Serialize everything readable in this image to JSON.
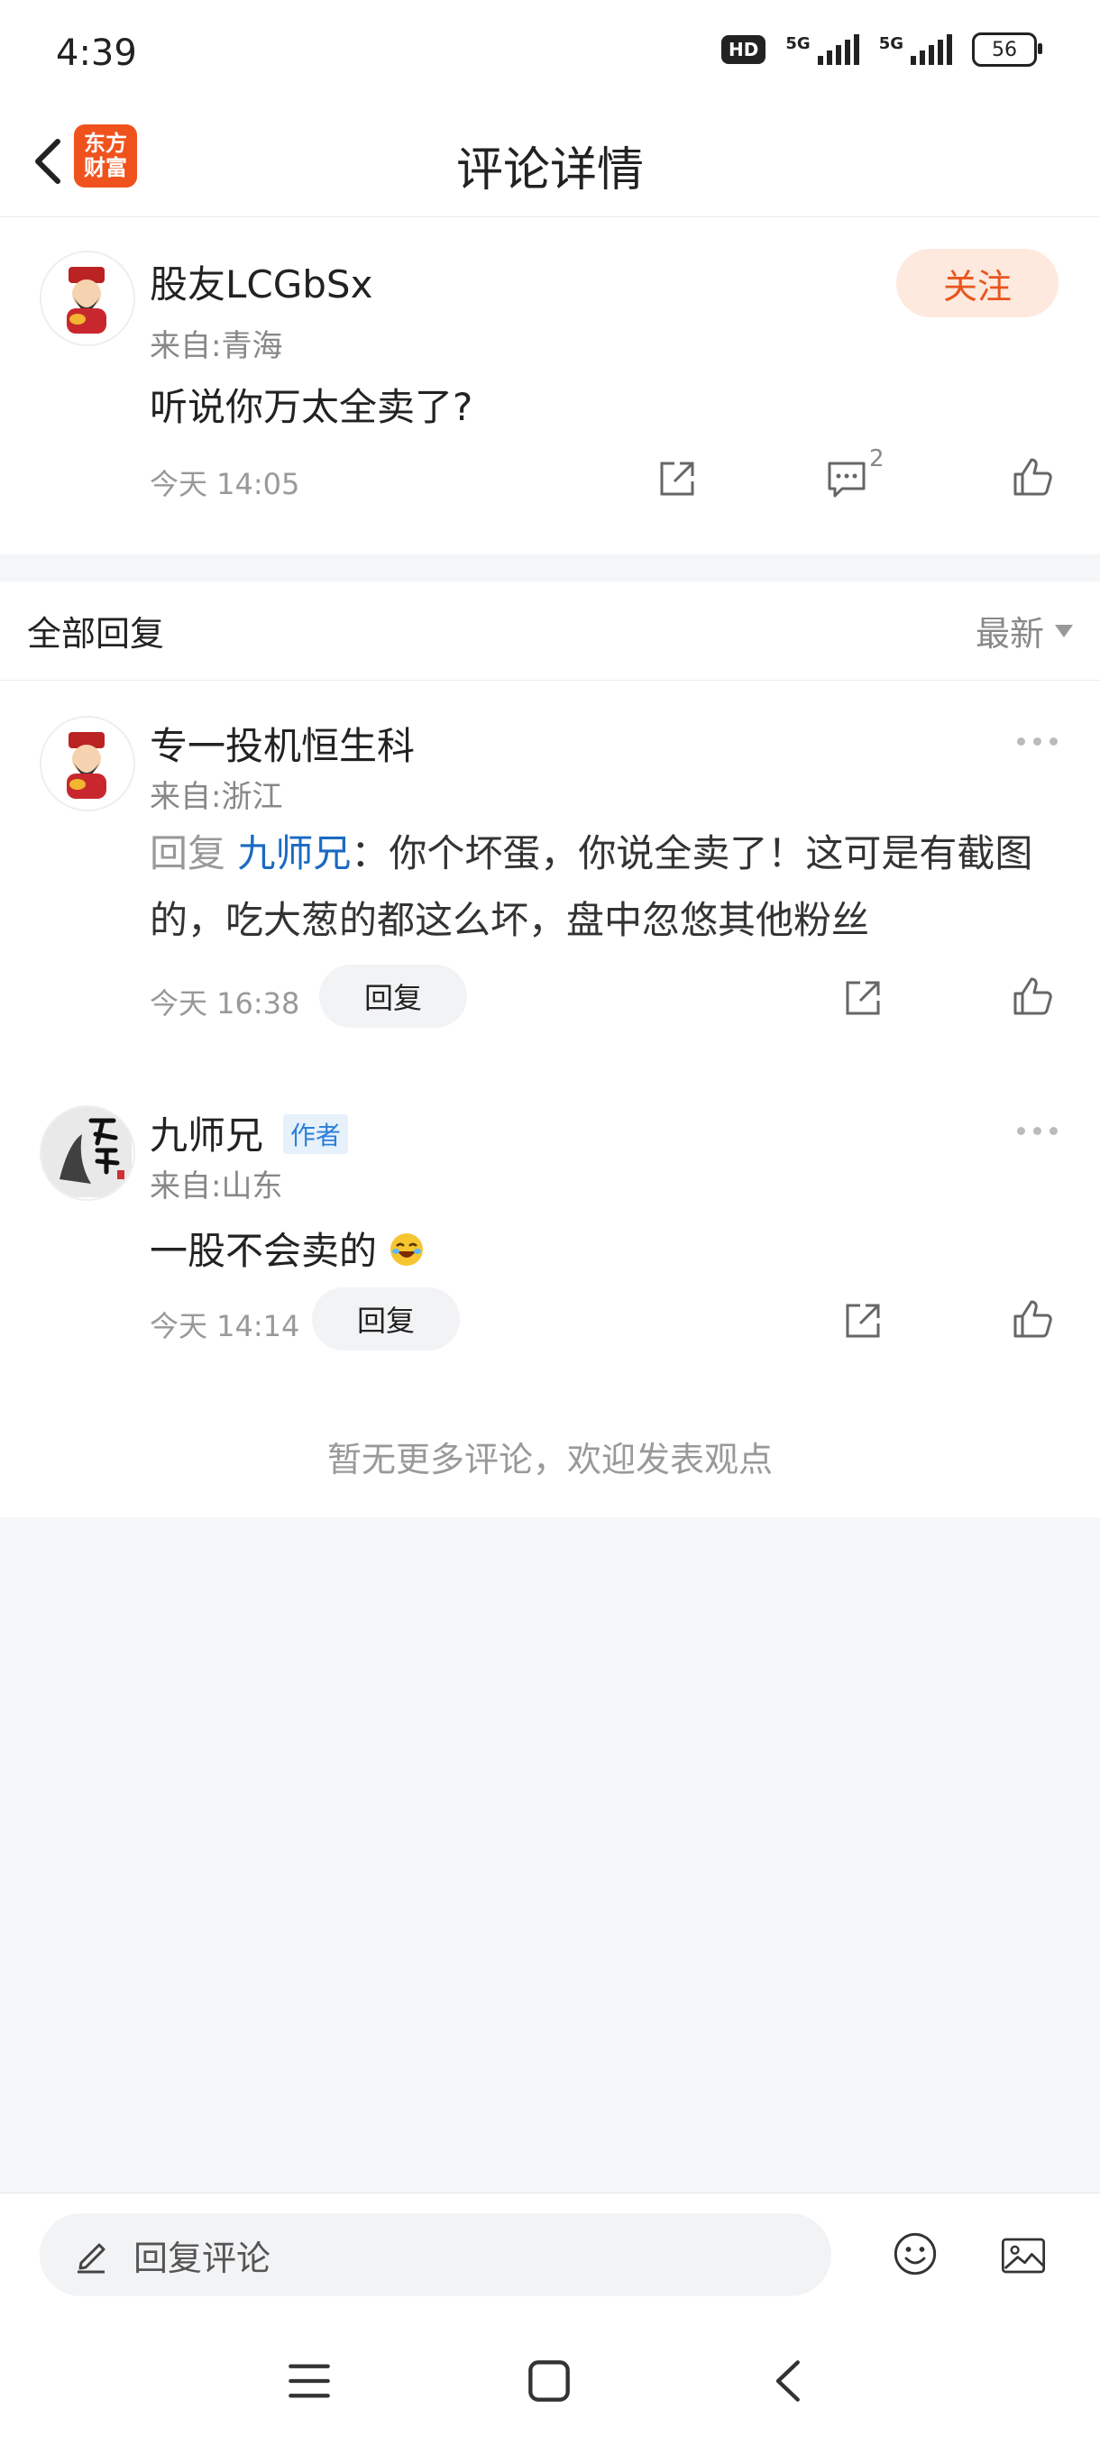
{
  "status_bar": {
    "time": "4:39",
    "network_1": "5G",
    "network_2": "5G",
    "battery": "56",
    "hd_label": "HD"
  },
  "header": {
    "title": "评论详情",
    "logo_line1": "东方",
    "logo_line2": "财富"
  },
  "main_comment": {
    "username": "股友LCGbSx",
    "location": "来自:青海",
    "text": "听说你万太全卖了?",
    "time": "今天 14:05",
    "follow_label": "关注",
    "comment_count": "2"
  },
  "replies_section": {
    "title": "全部回复",
    "sort_label": "最新"
  },
  "replies": [
    {
      "username": "专一投机恒生科",
      "location": "来自:浙江",
      "reply_prefix": "回复",
      "reply_to": "九师兄",
      "text": "：你个坏蛋，你说全卖了！这可是有截图的，吃大葱的都这么坏，盘中忽悠其他粉丝",
      "time": "今天 16:38",
      "reply_button": "回复"
    },
    {
      "username": "九师兄",
      "author_tag": "作者",
      "location": "来自:山东",
      "text": "一股不会卖的",
      "time": "今天 14:14",
      "reply_button": "回复"
    }
  ],
  "footer_note": "暂无更多评论，欢迎发表观点",
  "bottom_bar": {
    "input_placeholder": "回复评论"
  },
  "colors": {
    "accent": "#e8551e",
    "link_blue": "#1a6ac2",
    "follow_bg": "#fde9dd"
  }
}
